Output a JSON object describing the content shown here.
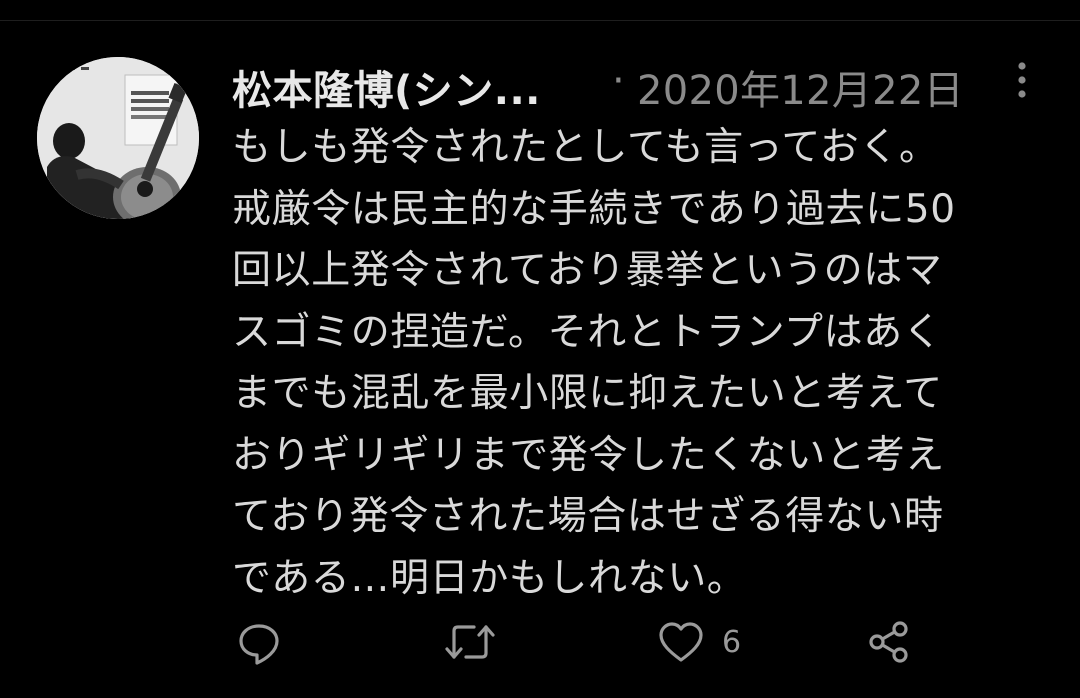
{
  "user": {
    "display_name": "松本隆博(シン...",
    "avatar_alt": "松本隆博"
  },
  "meta": {
    "separator": "·",
    "timestamp": "2020年12月22日"
  },
  "tweet": {
    "lines": [
      "もしも発令されたとしても言っておく。",
      "戒厳令は民主的な手続きであり過去に50",
      "回以上発令されており暴挙というのはマ",
      "スゴミの捏造だ。それとトランプはあく",
      "までも混乱を最小限に抑えたいと考えて",
      "おりギリギリまで発令したくないと考え",
      "ており発令された場合はせざる得ない時",
      "である…明日かもしれない。"
    ]
  },
  "actions": {
    "reply_icon": "reply-icon",
    "retweet_icon": "retweet-icon",
    "like_icon": "heart-icon",
    "like_count": "6",
    "share_icon": "share-icon"
  },
  "colors": {
    "background": "#000000",
    "text": "#d9d9d9",
    "muted": "#8a8a8a"
  }
}
